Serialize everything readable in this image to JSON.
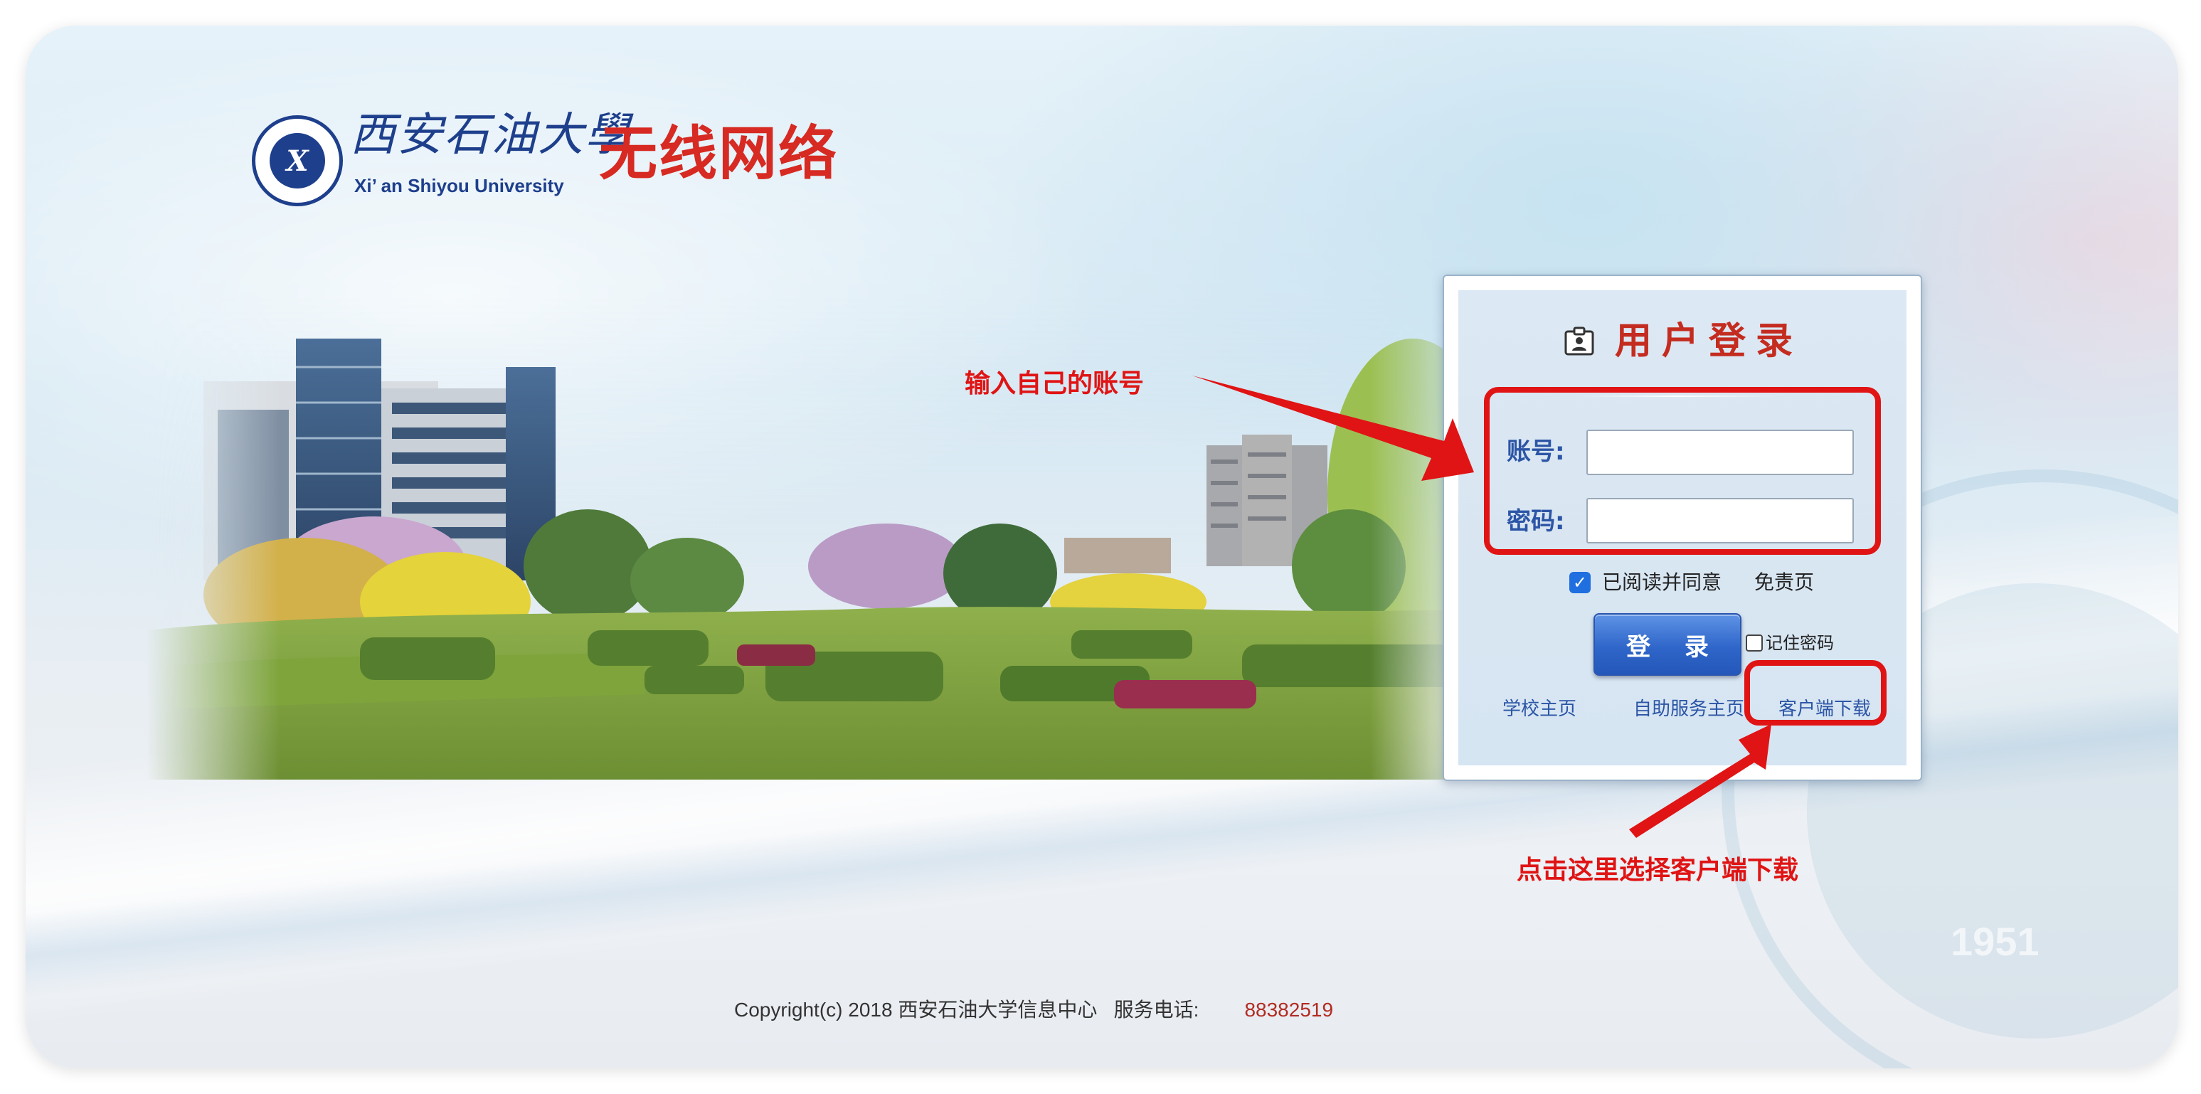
{
  "header": {
    "university_cn": "西安石油大學",
    "university_en": "Xi’ an Shiyou University",
    "title": "无线网络",
    "emblem_icon": "university-emblem"
  },
  "login": {
    "title": "用户登录",
    "title_icon": "id-card-icon",
    "account_label": "账号:",
    "account_value": "",
    "password_label": "密码:",
    "password_value": "",
    "agree_checked": true,
    "agree_text": "已阅读并同意",
    "disclaimer_link": "免责页",
    "login_button": "登 录",
    "remember_checked": false,
    "remember_text": "记住密码",
    "links": [
      "学校主页",
      "自助服务主页",
      "客户端下载"
    ]
  },
  "annotations": {
    "account_hint": "输入自己的账号",
    "client_hint": "点击这里选择客户端下载",
    "color": "#e01414"
  },
  "footer": {
    "copyright": "Copyright(c) 2018 西安石油大学信息中心   服务电话:",
    "phone": "88382519"
  },
  "watermark": {
    "year": "1951"
  },
  "colors": {
    "title_red": "#c42c20",
    "link_blue": "#2c55a6",
    "button_blue": "#2f66c9",
    "brand_navy": "#1e3f8c"
  }
}
